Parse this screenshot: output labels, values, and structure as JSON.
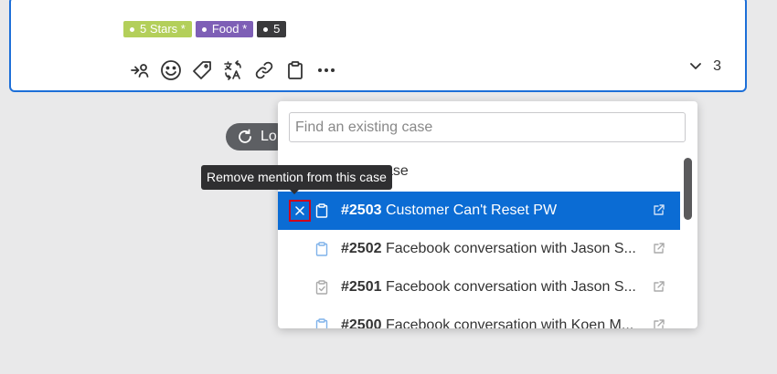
{
  "tags": [
    {
      "label": "5 Stars *",
      "color": "#b3cf5a"
    },
    {
      "label": "Food *",
      "color": "#7e5fb6"
    },
    {
      "label": "5",
      "color": "#3a3a3c"
    }
  ],
  "toolbar": {
    "icons": [
      "assign-icon",
      "emoji-icon",
      "tag-icon",
      "translate-icon",
      "link-icon",
      "case-clipboard-icon",
      "more-icon"
    ]
  },
  "replies": {
    "count": "3"
  },
  "load_button": {
    "label": "Lo"
  },
  "dropdown": {
    "search_placeholder": "Find an existing case",
    "section_label": "ase",
    "tooltip": "Remove mention from this case",
    "cases": [
      {
        "number": "#2503",
        "title": "Customer Can't Reset PW",
        "selected": true
      },
      {
        "number": "#2502",
        "title": "Facebook conversation with Jason S...",
        "selected": false
      },
      {
        "number": "#2501",
        "title": "Facebook conversation with Jason S...",
        "selected": false
      },
      {
        "number": "#2500",
        "title": "Facebook conversation with Koen M...",
        "selected": false
      }
    ]
  },
  "colors": {
    "accent": "#0b6cd4",
    "highlight": "#d0021b"
  }
}
